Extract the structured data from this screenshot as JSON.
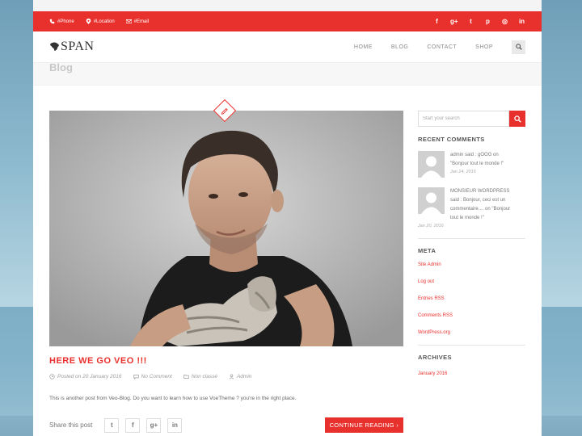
{
  "topbar": {
    "phone": "#Phone",
    "location": "#Location",
    "email": "#Email",
    "social_icons": [
      "facebook-icon",
      "google-plus-icon",
      "twitter-icon",
      "pinterest-icon",
      "dribbble-icon",
      "linkedin-icon"
    ],
    "social_glyphs": [
      "f",
      "g+",
      "t",
      "p",
      "◎",
      "in"
    ]
  },
  "header": {
    "logo": "SPAN",
    "nav": [
      "HOME",
      "BLOG",
      "CONTACT",
      "SHOP"
    ]
  },
  "page": {
    "title": "Blog"
  },
  "post": {
    "title": "HERE WE GO VEO !!!",
    "date": "Posted on 20 January 2016",
    "comments": "No Comment",
    "category": "Non classé",
    "author": "Admin",
    "excerpt": "This is another post from Veo-Blog. Do you want to learn how to use VoeTheme ? you're in the right place.",
    "share_label": "Share this post",
    "share_glyphs": [
      "t",
      "f",
      "g+",
      "in"
    ],
    "read_more": "CONTINUE READING ›"
  },
  "sidebar": {
    "search_placeholder": "Start your search",
    "recent_comments_title": "RECENT COMMENTS",
    "comments": [
      {
        "lines": [
          "admin said : gOOG on",
          "\"Bonjour tout le monde !\""
        ],
        "date": "Jan 24, 2016"
      },
      {
        "lines": [
          "MONSIEUR WORDPRESS",
          "said : Bonjour, ceci est un",
          "commentaire.... on \"Bonjour",
          "tout le monde !\""
        ],
        "date": "Jan 20, 2016"
      }
    ],
    "meta_title": "META",
    "meta_links": [
      "Site Admin",
      "Log out",
      "Entries RSS",
      "Comments RSS",
      "WordPress.org"
    ],
    "archives_title": "ARCHIVES",
    "archives": [
      "January 2016"
    ]
  },
  "colors": {
    "accent": "#e8302d"
  }
}
